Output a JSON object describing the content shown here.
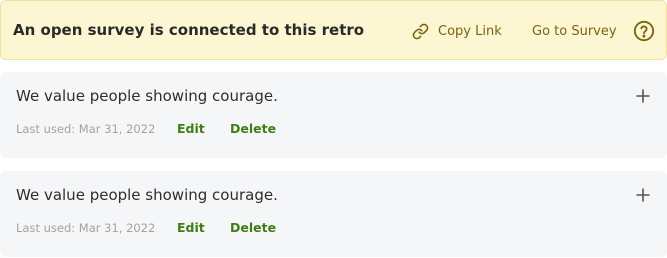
{
  "banner": {
    "title": "An open survey is connected to this retro",
    "copy_link_label": "Copy Link",
    "copy_link_icon": "link-icon",
    "go_to_survey_label": "Go to Survey",
    "help_icon": "question-circle-icon",
    "colors": {
      "background": "#fcf7d2",
      "accent": "#7a6310"
    }
  },
  "cards": [
    {
      "title": "We value people showing courage.",
      "last_used": "Last used: Mar 31, 2022",
      "edit_label": "Edit",
      "delete_label": "Delete",
      "add_icon": "plus-icon"
    },
    {
      "title": "We value people showing courage.",
      "last_used": "Last used: Mar 31, 2022",
      "edit_label": "Edit",
      "delete_label": "Delete",
      "add_icon": "plus-icon"
    }
  ],
  "colors": {
    "action_green": "#3f7d15",
    "card_background": "#f5f6f8"
  }
}
